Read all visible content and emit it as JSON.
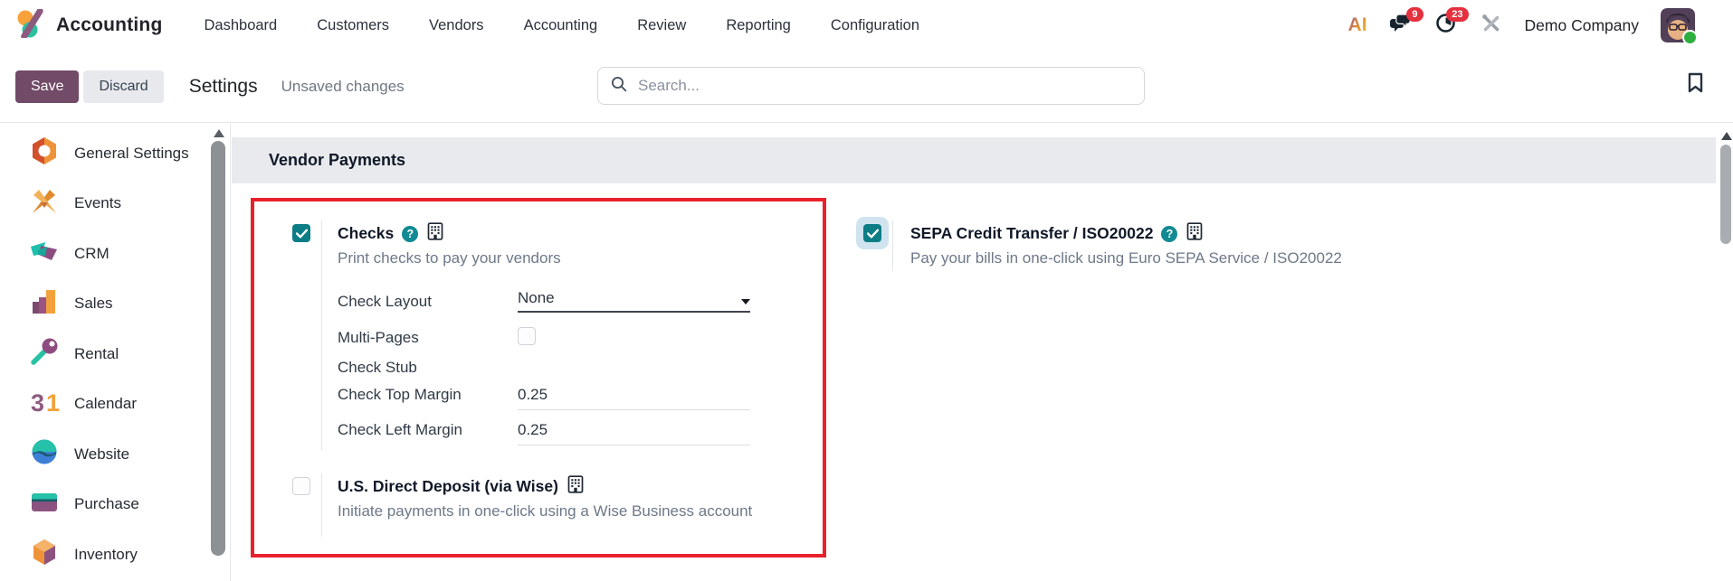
{
  "navbar": {
    "app_name": "Accounting",
    "menu": [
      "Dashboard",
      "Customers",
      "Vendors",
      "Accounting",
      "Review",
      "Reporting",
      "Configuration"
    ],
    "ai_label": "AI",
    "messages_badge": "9",
    "activities_badge": "23",
    "company": "Demo Company"
  },
  "control_bar": {
    "save": "Save",
    "discard": "Discard",
    "title": "Settings",
    "status": "Unsaved changes",
    "search_placeholder": "Search..."
  },
  "sidebar": {
    "items": [
      {
        "label": "General Settings",
        "icon": "general-settings-icon"
      },
      {
        "label": "Events",
        "icon": "events-icon"
      },
      {
        "label": "CRM",
        "icon": "crm-icon"
      },
      {
        "label": "Sales",
        "icon": "sales-icon"
      },
      {
        "label": "Rental",
        "icon": "rental-icon"
      },
      {
        "label": "Calendar",
        "icon": "calendar-icon"
      },
      {
        "label": "Website",
        "icon": "website-icon"
      },
      {
        "label": "Purchase",
        "icon": "purchase-icon"
      },
      {
        "label": "Inventory",
        "icon": "inventory-icon"
      }
    ]
  },
  "content": {
    "section_title": "Vendor Payments",
    "checks": {
      "title": "Checks",
      "checked": true,
      "description": "Print checks to pay your vendors",
      "fields": {
        "layout": {
          "label": "Check Layout",
          "value": "None"
        },
        "multi_pages": {
          "label": "Multi-Pages",
          "checked": false
        },
        "stub": {
          "label": "Check Stub"
        },
        "top_margin": {
          "label": "Check Top Margin",
          "value": "0.25"
        },
        "left_margin": {
          "label": "Check Left Margin",
          "value": "0.25"
        }
      }
    },
    "direct_deposit": {
      "title": "U.S. Direct Deposit (via Wise)",
      "checked": false,
      "description": "Initiate payments in one-click using a Wise Business account"
    },
    "sepa": {
      "title": "SEPA Credit Transfer / ISO20022",
      "checked": true,
      "description": "Pay your bills in one-click using Euro SEPA Service / ISO20022"
    }
  },
  "colors": {
    "primary_purple": "#714B67",
    "checkbox_teal": "#0b7d85",
    "highlight_red": "#e8212b",
    "badge_red": "#e5303e",
    "section_band_gray": "#e8eaed"
  }
}
